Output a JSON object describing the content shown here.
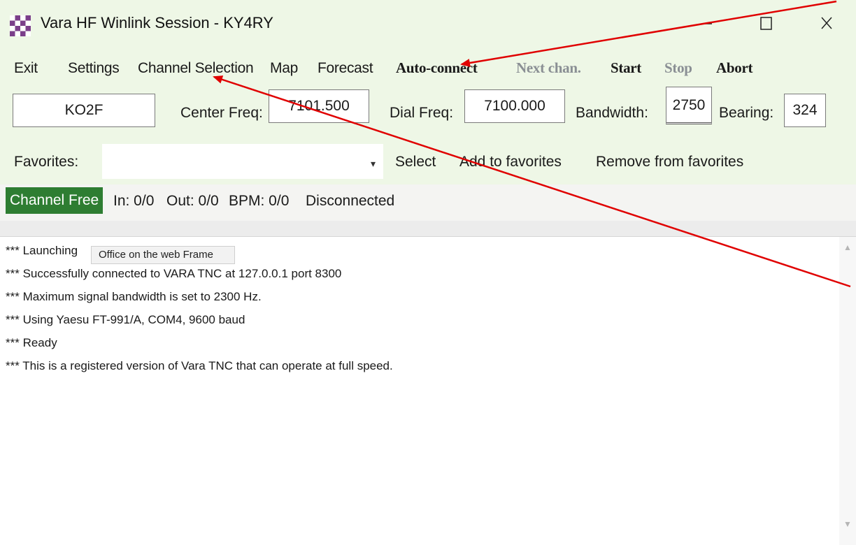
{
  "window": {
    "title": "Vara HF Winlink Session - KY4RY",
    "icon": "checkered-app-icon",
    "controls": {
      "minimize": "minimize-icon",
      "maximize": "maximize-icon",
      "close": "close-icon"
    }
  },
  "menu": {
    "exit": "Exit",
    "settings": "Settings",
    "channel_selection": "Channel Selection",
    "map": "Map",
    "forecast": "Forecast",
    "auto_connect": "Auto-connect",
    "next_chan": "Next chan.",
    "start": "Start",
    "stop": "Stop",
    "abort": "Abort"
  },
  "fields": {
    "callsign": "KO2F",
    "center_freq_label": "Center Freq:",
    "center_freq": "7101.500",
    "dial_freq_label": "Dial Freq:",
    "dial_freq": "7100.000",
    "bandwidth_label": "Bandwidth:",
    "bandwidth": "2750",
    "bearing_label": "Bearing:",
    "bearing": "324"
  },
  "favorites": {
    "label": "Favorites:",
    "value": "",
    "select": "Select",
    "add": "Add to favorites",
    "remove": "Remove from favorites"
  },
  "status": {
    "channel": "Channel Free",
    "in": "In: 0/0",
    "out": "Out: 0/0",
    "bpm": "BPM: 0/0",
    "connection": "Disconnected"
  },
  "log": [
    "*** Launching",
    "*** Successfully connected to VARA TNC at 127.0.0.1 port 8300",
    "*** Maximum signal bandwidth is set to 2300 Hz.",
    "*** Using Yaesu FT-991/A, COM4, 9600 baud",
    "*** Ready",
    "*** This is a registered version of Vara TNC that can operate at full speed."
  ],
  "tooltip": "Office on the web Frame",
  "colors": {
    "toolbar_bg": "#eef7e6",
    "channel_free_bg": "#2e7d32",
    "annotation_arrow": "#e00000"
  }
}
